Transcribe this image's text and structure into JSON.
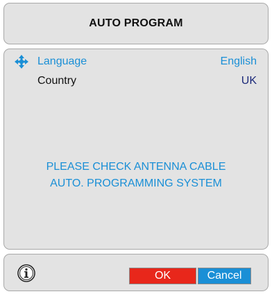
{
  "header": {
    "title": "AUTO PROGRAM"
  },
  "settings": {
    "rows": [
      {
        "label": "Language",
        "value": "English"
      },
      {
        "label": "Country",
        "value": "UK"
      }
    ]
  },
  "message": {
    "line1": "PLEASE CHECK ANTENNA CABLE",
    "line2": "AUTO. PROGRAMMING SYSTEM"
  },
  "footer": {
    "info_icon": "info-icon",
    "ok_label": "OK",
    "cancel_label": "Cancel"
  },
  "colors": {
    "panel_bg": "#e3e3e3",
    "accent_blue": "#1a8fd6",
    "ok_red": "#e8271b",
    "country_value": "#1c2a7a"
  }
}
